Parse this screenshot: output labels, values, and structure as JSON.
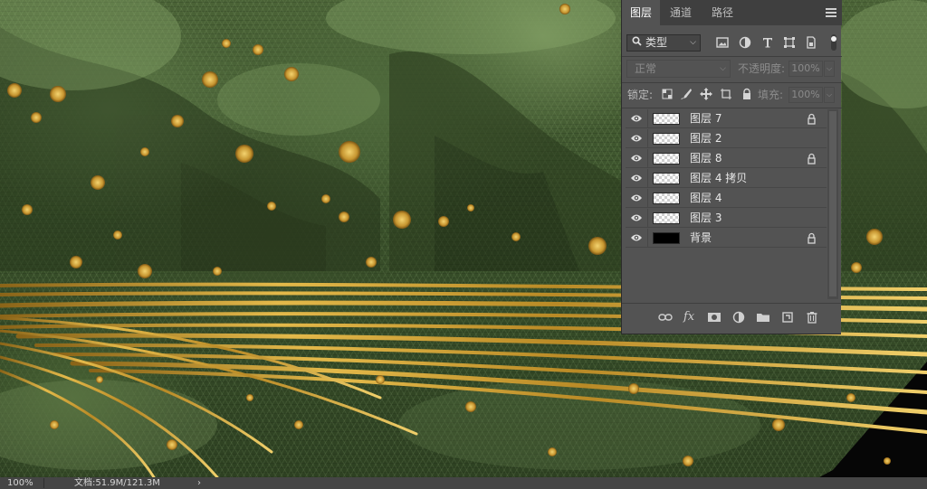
{
  "status_bar": {
    "zoom": "100%",
    "doc_info": "文档:51.9M/121.3M",
    "arrow": "›"
  },
  "layers_panel": {
    "tabs": [
      {
        "label": "图层",
        "active": true
      },
      {
        "label": "通道",
        "active": false
      },
      {
        "label": "路径",
        "active": false
      }
    ],
    "filter": {
      "kind_label": "类型",
      "icons": [
        "image-filter-icon",
        "adjustment-filter-icon",
        "type-filter-icon",
        "shape-filter-icon",
        "smart-object-filter-icon"
      ]
    },
    "blend_mode": "正常",
    "opacity_label": "不透明度:",
    "opacity_value": "100%",
    "lock_label": "锁定:",
    "fill_label": "填充:",
    "fill_value": "100%",
    "layers": [
      {
        "name": "图层 7",
        "thumbnail": "transparent",
        "locked": true
      },
      {
        "name": "图层 2",
        "thumbnail": "transparent",
        "locked": false
      },
      {
        "name": "图层 8",
        "thumbnail": "transparent",
        "locked": true
      },
      {
        "name": "图层 4 拷贝",
        "thumbnail": "transparent",
        "locked": false
      },
      {
        "name": "图层 4",
        "thumbnail": "transparent",
        "locked": false
      },
      {
        "name": "图层 3",
        "thumbnail": "transparent",
        "locked": false
      },
      {
        "name": "背景",
        "thumbnail": "black",
        "locked": true
      }
    ],
    "bottom_icons": [
      "link-layers-icon",
      "fx-icon",
      "layer-mask-icon",
      "adjustment-layer-icon",
      "new-group-icon",
      "new-layer-icon",
      "delete-layer-icon"
    ]
  },
  "colors": {
    "panel_bg": "#535353",
    "tab_bar_bg": "#3f3f3f",
    "status_bar_bg": "#454545",
    "gold": "#d4a830"
  }
}
